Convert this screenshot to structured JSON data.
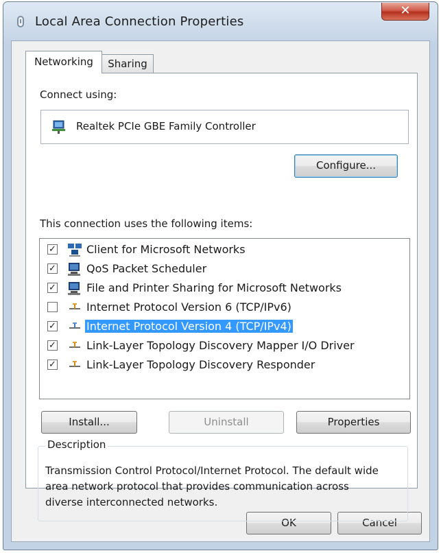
{
  "window": {
    "title": "Local Area Connection Properties",
    "close_glyph": "✕"
  },
  "tabs": [
    {
      "label": "Networking",
      "active": true
    },
    {
      "label": "Sharing",
      "active": false
    }
  ],
  "connect_using": {
    "label": "Connect using:",
    "adapter_icon": "network-adapter-icon",
    "adapter_name": "Realtek PCIe GBE Family Controller"
  },
  "configure_button": "Configure...",
  "items_label": "This connection uses the following items:",
  "items": [
    {
      "label": "Client for Microsoft Networks",
      "checked": true,
      "icon": "network-client-icon"
    },
    {
      "label": "QoS Packet Scheduler",
      "checked": true,
      "icon": "computer-service-icon"
    },
    {
      "label": "File and Printer Sharing for Microsoft Networks",
      "checked": true,
      "icon": "computer-service-icon"
    },
    {
      "label": "Internet Protocol Version 6 (TCP/IPv6)",
      "checked": false,
      "icon": "protocol-icon"
    },
    {
      "label": "Internet Protocol Version 4 (TCP/IPv4)",
      "checked": true,
      "icon": "protocol-icon",
      "selected": true
    },
    {
      "label": "Link-Layer Topology Discovery Mapper I/O Driver",
      "checked": true,
      "icon": "protocol-icon"
    },
    {
      "label": "Link-Layer Topology Discovery Responder",
      "checked": true,
      "icon": "protocol-icon"
    }
  ],
  "buttons": {
    "install": "Install...",
    "uninstall": "Uninstall",
    "properties": "Properties",
    "ok": "OK",
    "cancel": "Cancel"
  },
  "description": {
    "title": "Description",
    "text": "Transmission Control Protocol/Internet Protocol. The default wide area network protocol that provides communication across diverse interconnected networks."
  },
  "colors": {
    "selection": "#3399ff",
    "close_button": "#c1402e",
    "window_frame": "#c3d3e6"
  }
}
